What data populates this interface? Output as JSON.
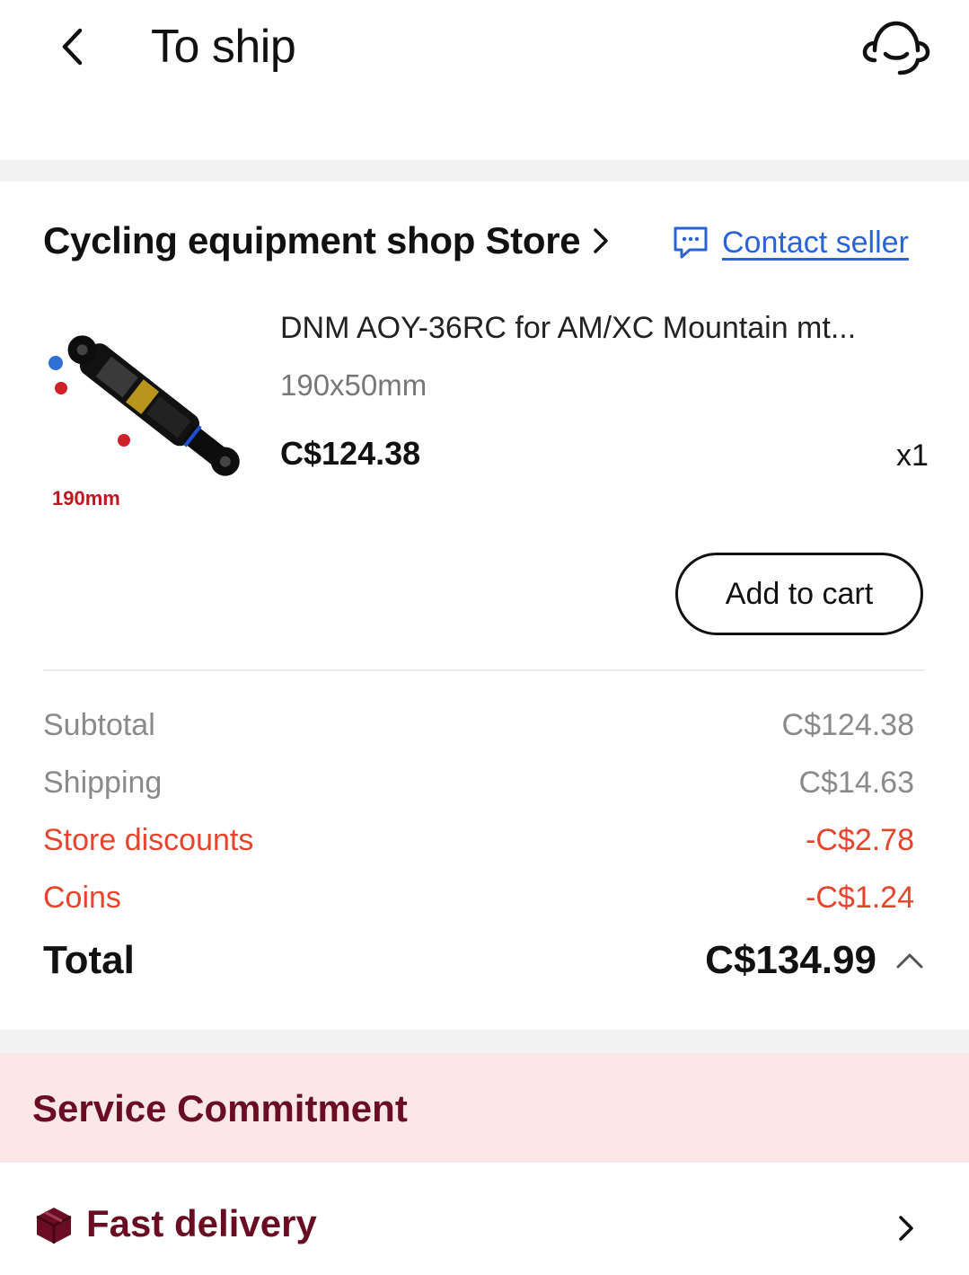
{
  "header": {
    "title": "To ship",
    "back_icon": "chevron-left-icon",
    "support_icon": "headset-icon"
  },
  "store": {
    "name": "Cycling equipment shop Store",
    "contact_label": "Contact seller",
    "contact_icon": "chat-bubble-icon"
  },
  "product": {
    "image_label": "190mm",
    "title": "DNM AOY-36RC for AM/XC Mountain mt...",
    "variant": "190x50mm",
    "price": "C$124.38",
    "quantity": "x1",
    "add_to_cart_label": "Add to cart"
  },
  "summary": {
    "rows": [
      {
        "label": "Subtotal",
        "value": "C$124.38"
      },
      {
        "label": "Shipping",
        "value": "C$14.63"
      },
      {
        "label": "Store discounts",
        "value": "-C$2.78"
      },
      {
        "label": "Coins",
        "value": "-C$1.24"
      }
    ],
    "total_label": "Total",
    "total_value": "C$134.99"
  },
  "service": {
    "title": "Service Commitment",
    "items": [
      {
        "label": "Fast delivery",
        "icon": "package-box-icon"
      }
    ]
  },
  "colors": {
    "accent_link": "#2a63d6",
    "discount_red": "#e8442d",
    "service_maroon": "#6b0d22",
    "service_bg": "#fbe6e8"
  }
}
